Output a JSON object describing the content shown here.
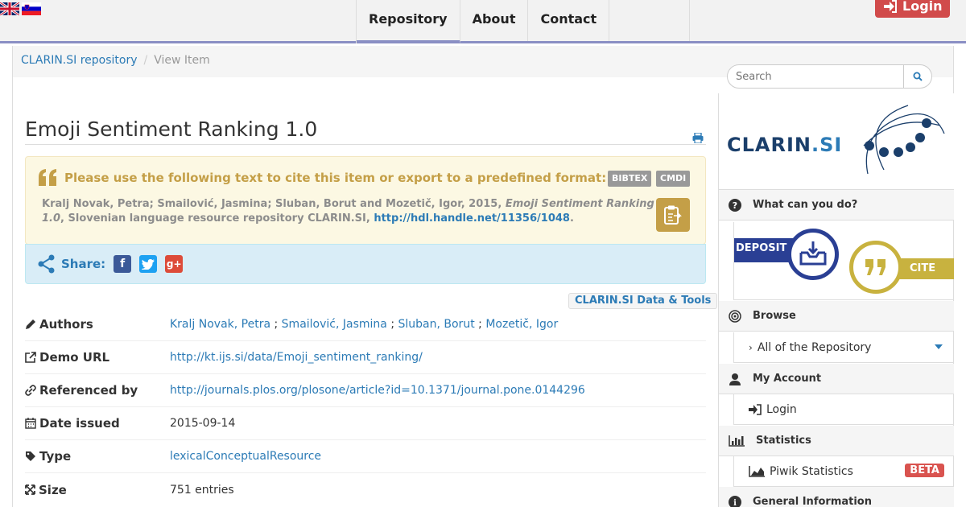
{
  "header": {
    "nav": [
      "Repository",
      "About",
      "Contact"
    ],
    "login_label": "Login"
  },
  "breadcrumb": {
    "home": "CLARIN.SI repository",
    "current": "View Item"
  },
  "search": {
    "placeholder": "Search"
  },
  "item": {
    "title": "Emoji Sentiment Ranking 1.0",
    "cite_heading": "Please use the following text to cite this item or export to a predefined format:",
    "export_formats": [
      "BIBTEX",
      "CMDI"
    ],
    "citation_authors": "Kralj Novak, Petra; Smailović, Jasmina; Sluban, Borut and Mozetič, Igor, 2015,",
    "citation_title": "Emoji Sentiment Ranking 1.0",
    "citation_repo": ", Slovenian language resource repository CLARIN.SI,",
    "citation_link": "http://hdl.handle.net/11356/1048",
    "citation_end": ".",
    "share_label": "Share:",
    "data_tools": "CLARIN.SI Data & Tools",
    "fields": {
      "authors_label": "Authors",
      "authors": [
        "Kralj Novak, Petra",
        "Smailović, Jasmina",
        "Sluban, Borut",
        "Mozetič, Igor"
      ],
      "author_sep": ";",
      "demo_label": "Demo URL",
      "demo_url": "http://kt.ijs.si/data/Emoji_sentiment_ranking/",
      "ref_label": "Referenced by",
      "ref_url": "http://journals.plos.org/plosone/article?id=10.1371/journal.pone.0144296",
      "date_label": "Date issued",
      "date": "2015-09-14",
      "type_label": "Type",
      "type": "lexicalConceptualResource",
      "size_label": "Size",
      "size": "751 entries"
    }
  },
  "sidebar": {
    "logo_text": "CLARIN",
    "logo_suffix": ".SI",
    "what_label": "What can you do?",
    "deposit_label": "DEPOSIT",
    "cite_label": "CITE",
    "browse_label": "Browse",
    "browse_item": "All of the Repository",
    "account_label": "My Account",
    "account_item": "Login",
    "stats_label": "Statistics",
    "stats_item": "Piwik Statistics",
    "beta": "BETA",
    "general_label": "General Information"
  }
}
